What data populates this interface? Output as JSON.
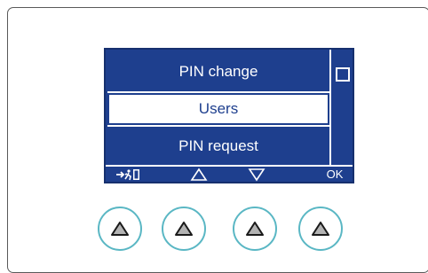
{
  "menu": {
    "items": [
      "PIN change",
      "Users",
      "PIN request"
    ],
    "selected_index": 1
  },
  "softkeys": {
    "exit_icon": "exit-door-icon",
    "up_icon": "triangle-up-outline-icon",
    "down_icon": "triangle-down-outline-icon",
    "ok_label": "OK"
  },
  "colors": {
    "lcd_background": "#1e3f8e",
    "lcd_foreground": "#ffffff",
    "button_ring": "#5ab7c4",
    "button_triangle": "#b3b3b3"
  },
  "hardware_buttons": [
    {
      "icon": "triangle-up-icon"
    },
    {
      "icon": "triangle-up-icon"
    },
    {
      "icon": "triangle-up-icon"
    },
    {
      "icon": "triangle-up-icon"
    }
  ]
}
